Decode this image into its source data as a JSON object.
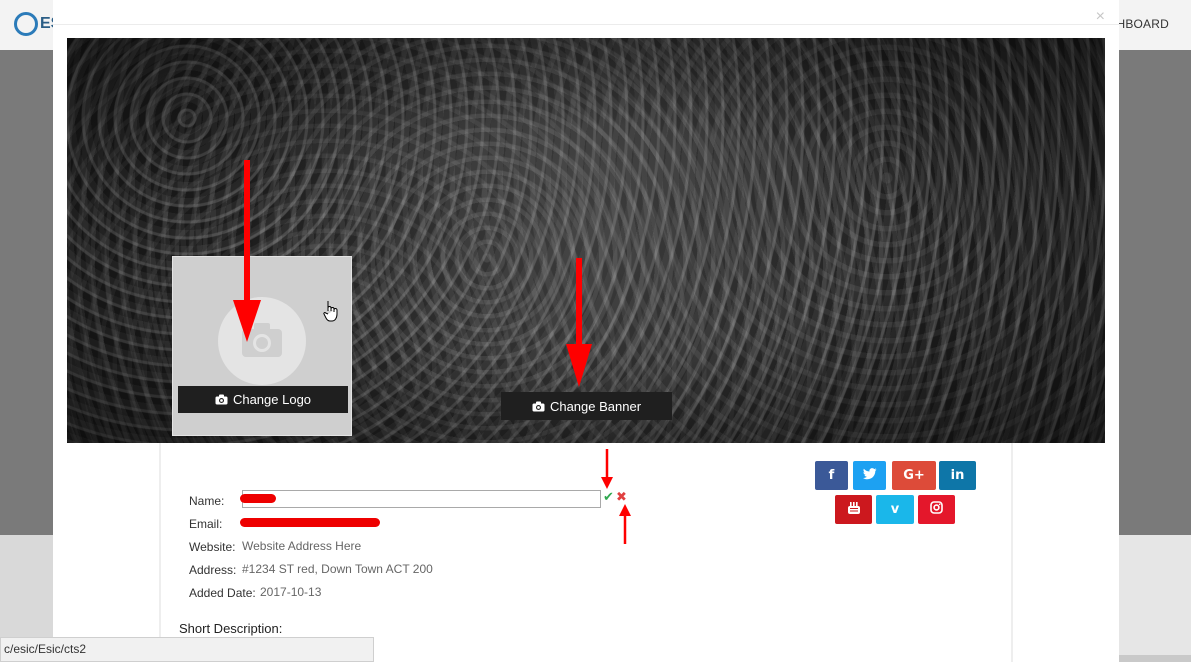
{
  "background": {
    "logo_text": "ES",
    "nav_item": "SHBOARD"
  },
  "modal": {
    "close_glyph": "×",
    "change_logo_label": "Change Logo",
    "change_banner_label": "Change Banner"
  },
  "profile": {
    "name_label": "Name:",
    "email_label": "Email:",
    "website_label": "Website:",
    "website_value": "Website Address Here",
    "address_label": "Address:",
    "address_value": "#1234 ST red, Down Town ACT 200",
    "added_date_label": "Added Date:",
    "added_date_value": "2017-10-13",
    "short_description_label": "Short Description:"
  },
  "social": [
    {
      "icon": "facebook-icon",
      "glyph": "f",
      "color": "#3b5998"
    },
    {
      "icon": "twitter-icon",
      "glyph": "🐦",
      "color": "#1da1f2"
    },
    {
      "icon": "google-plus-icon",
      "glyph": "G+",
      "color": "#dd4b39"
    },
    {
      "icon": "linkedin-icon",
      "glyph": "in",
      "color": "#0e76a8"
    },
    {
      "icon": "youtube-icon",
      "glyph": "▶",
      "color": "#cc181e"
    },
    {
      "icon": "vimeo-icon",
      "glyph": "v",
      "color": "#1ab7ea"
    },
    {
      "icon": "instagram-icon",
      "glyph": "◎",
      "color": "#e4172b"
    }
  ],
  "status_bar": {
    "url": "c/esic/Esic/cts2"
  }
}
